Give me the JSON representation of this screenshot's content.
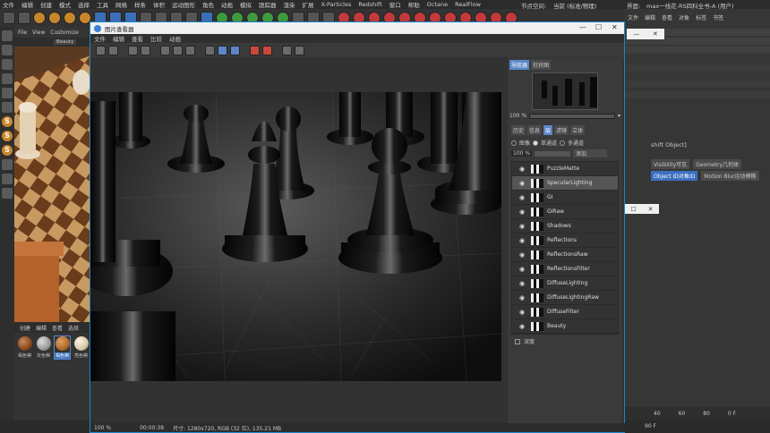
{
  "menubar": {
    "items": [
      "文件",
      "编辑",
      "创建",
      "模式",
      "选择",
      "工具",
      "网格",
      "样条",
      "体积",
      "运动图形",
      "角色",
      "动画",
      "模拟",
      "跟踪器",
      "渲染",
      "扩展",
      "X-Particles",
      "Redshift",
      "窗口",
      "帮助",
      "Octane",
      "RealFlow"
    ],
    "node_space_label": "节点空间:",
    "node_space_value": "当前 (标准/物理)",
    "interface_label": "界面:",
    "interface_value": "max一线花-RS四科全书-A (用户)"
  },
  "left_viewport": {
    "menu": [
      "File",
      "View",
      "Customize"
    ],
    "beauty": "Beauty"
  },
  "material_panel": {
    "menu": [
      "创建",
      "编辑",
      "查看",
      "选择"
    ],
    "materials": [
      {
        "label": "褐色棋",
        "color": "#8a4a1e"
      },
      {
        "label": "灰色棋",
        "color": "#9a9a9a"
      },
      {
        "label": "褐色棋",
        "color": "#b06a2a"
      },
      {
        "label": "亮色棋",
        "color": "#d8c8a8"
      }
    ]
  },
  "right_panel": {
    "menu": [
      "文件",
      "编辑",
      "查看",
      "对象",
      "标签",
      "书签"
    ],
    "attr_title": "shift Object]",
    "tags": [
      [
        "Visibility可见",
        "Geometry几何体"
      ],
      [
        "Object ID对象ID",
        "Motion Blur运动模糊"
      ]
    ],
    "timeline": [
      "40",
      "60",
      "80"
    ],
    "frame_end": "90 F",
    "frame_current": "0 F"
  },
  "viewer": {
    "title": "图片查看器",
    "menu": [
      "文件",
      "编辑",
      "查看",
      "比较",
      "动画"
    ],
    "side_tabs": [
      "导航器",
      "柱状图"
    ],
    "side_zoom": "100 %",
    "tabs2": [
      "历史",
      "信息",
      "层",
      "滤镜",
      "立体"
    ],
    "radio_image": "图像",
    "radio_single": "单通道",
    "radio_multi": "多通道",
    "opacity": "100 %",
    "blend": "添加",
    "layers": [
      "PuzzleMatte",
      "SpecularLighting",
      "GI",
      "GIRaw",
      "Shadows",
      "Reflections",
      "ReflectionsRaw",
      "ReflectionsFilter",
      "DiffuseLighting",
      "DiffuseLightingRaw",
      "DiffuseFilter",
      "Beauty"
    ],
    "last_layer": "深度",
    "status_zoom": "100 %",
    "status_time": "00:00:38",
    "status_info": "尺寸: 1280x720, RGB (32 位), 135.21 MB"
  }
}
